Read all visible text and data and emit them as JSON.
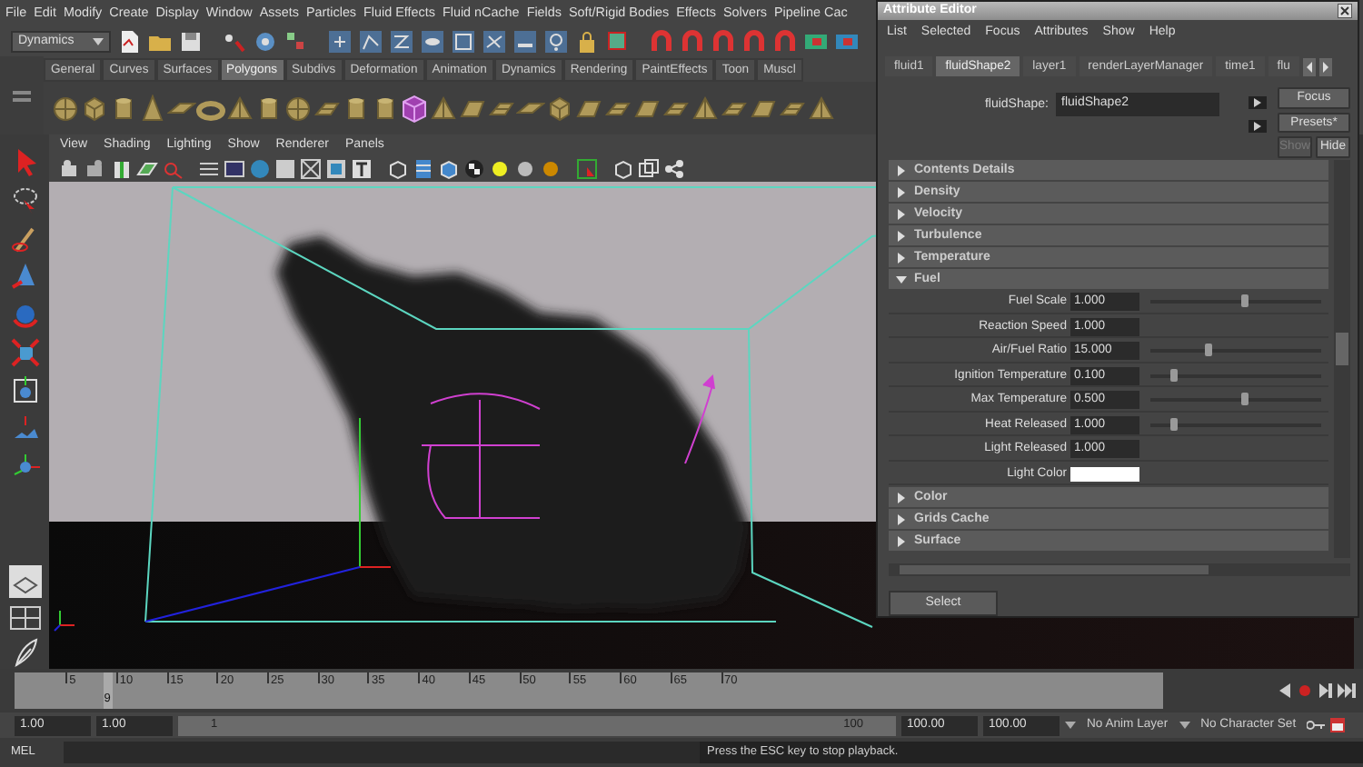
{
  "menu_bar": [
    "File",
    "Edit",
    "Modify",
    "Create",
    "Display",
    "Window",
    "Assets",
    "Particles",
    "Fluid Effects",
    "Fluid nCache",
    "Fields",
    "Soft/Rigid Bodies",
    "Effects",
    "Solvers",
    "Pipeline Cac"
  ],
  "status_line": {
    "menu_set": "Dynamics"
  },
  "shelf": {
    "tabs": [
      {
        "label": "General",
        "selected": false
      },
      {
        "label": "Curves",
        "selected": false
      },
      {
        "label": "Surfaces",
        "selected": false
      },
      {
        "label": "Polygons",
        "selected": true
      },
      {
        "label": "Subdivs",
        "selected": false
      },
      {
        "label": "Deformation",
        "selected": false
      },
      {
        "label": "Animation",
        "selected": false
      },
      {
        "label": "Dynamics",
        "selected": false
      },
      {
        "label": "Rendering",
        "selected": false
      },
      {
        "label": "PaintEffects",
        "selected": false
      },
      {
        "label": "Toon",
        "selected": false
      },
      {
        "label": "Muscl",
        "selected": false
      }
    ]
  },
  "viewport": {
    "menu": [
      "View",
      "Shading",
      "Lighting",
      "Show",
      "Renderer",
      "Panels"
    ]
  },
  "time_slider": {
    "ticks": [
      "5",
      "10",
      "15",
      "20",
      "25",
      "30",
      "35",
      "40",
      "45",
      "50",
      "55",
      "60",
      "65",
      "70"
    ],
    "current_frame": {
      "label": "9",
      "level": 0.078
    }
  },
  "range_slider": {
    "level": 1,
    "start_time": "1.00",
    "playback_start": "1.00",
    "range_start": "1",
    "range_end": "100",
    "playback_end": "100.00",
    "end_time": "100.00",
    "anim_layer": "No Anim Layer",
    "character_set": "No Character Set"
  },
  "command_line": {
    "language": "MEL",
    "help_line": "Press the ESC key to stop playback."
  },
  "attribute_editor": {
    "title": "Attribute Editor",
    "menu": [
      "List",
      "Selected",
      "Focus",
      "Attributes",
      "Show",
      "Help"
    ],
    "tabs": [
      {
        "label": "fluid1",
        "selected": false
      },
      {
        "label": "fluidShape2",
        "selected": true
      },
      {
        "label": "layer1",
        "selected": false
      },
      {
        "label": "renderLayerManager",
        "selected": false
      },
      {
        "label": "time1",
        "selected": false
      },
      {
        "label": "flu",
        "selected": false
      }
    ],
    "node_label": "fluidShape:",
    "node_name": "fluidShape2",
    "buttons": [
      {
        "label": "Focus",
        "disabled": false
      },
      {
        "label": "Presets*",
        "disabled": false
      },
      {
        "label": "Show",
        "disabled": true
      },
      {
        "label": "Hide",
        "disabled": false
      }
    ],
    "sections": [
      {
        "title": "Contents Details",
        "expanded": false
      },
      {
        "title": "Density",
        "expanded": false
      },
      {
        "title": "Velocity",
        "expanded": false
      },
      {
        "title": "Turbulence",
        "expanded": false
      },
      {
        "title": "Temperature",
        "expanded": false
      },
      {
        "title": "Fuel",
        "expanded": true,
        "attributes": [
          {
            "kind": "slider",
            "label": "Fuel Scale",
            "value": "1.000",
            "level": 0.55
          },
          {
            "kind": "field",
            "label": "Reaction Speed",
            "value": "1.000"
          },
          {
            "kind": "slider",
            "label": "Air/Fuel Ratio",
            "value": "15.000",
            "level": 0.34
          },
          {
            "kind": "slider",
            "label": "Ignition Temperature",
            "value": "0.100",
            "level": 0.14
          },
          {
            "kind": "slider",
            "label": "Max Temperature",
            "value": "0.500",
            "level": 0.55
          },
          {
            "kind": "slider",
            "label": "Heat Released",
            "value": "1.000",
            "level": 0.14
          },
          {
            "kind": "field",
            "label": "Light Released",
            "value": "1.000"
          },
          {
            "kind": "color",
            "label": "Light Color",
            "color": "#ffffff"
          }
        ]
      },
      {
        "title": "Color",
        "expanded": false
      },
      {
        "title": "Grids Cache",
        "expanded": false
      },
      {
        "title": "Surface",
        "expanded": false
      }
    ],
    "bottom_buttons": [
      "Select"
    ]
  }
}
